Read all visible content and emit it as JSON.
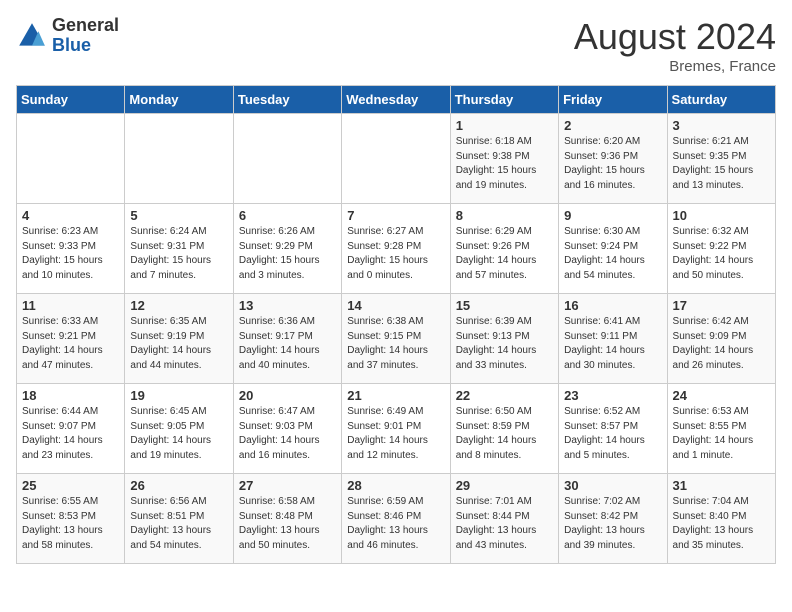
{
  "header": {
    "logo_general": "General",
    "logo_blue": "Blue",
    "month_title": "August 2024",
    "subtitle": "Bremes, France"
  },
  "days_of_week": [
    "Sunday",
    "Monday",
    "Tuesday",
    "Wednesday",
    "Thursday",
    "Friday",
    "Saturday"
  ],
  "weeks": [
    [
      {
        "day": "",
        "detail": ""
      },
      {
        "day": "",
        "detail": ""
      },
      {
        "day": "",
        "detail": ""
      },
      {
        "day": "",
        "detail": ""
      },
      {
        "day": "1",
        "detail": "Sunrise: 6:18 AM\nSunset: 9:38 PM\nDaylight: 15 hours\nand 19 minutes."
      },
      {
        "day": "2",
        "detail": "Sunrise: 6:20 AM\nSunset: 9:36 PM\nDaylight: 15 hours\nand 16 minutes."
      },
      {
        "day": "3",
        "detail": "Sunrise: 6:21 AM\nSunset: 9:35 PM\nDaylight: 15 hours\nand 13 minutes."
      }
    ],
    [
      {
        "day": "4",
        "detail": "Sunrise: 6:23 AM\nSunset: 9:33 PM\nDaylight: 15 hours\nand 10 minutes."
      },
      {
        "day": "5",
        "detail": "Sunrise: 6:24 AM\nSunset: 9:31 PM\nDaylight: 15 hours\nand 7 minutes."
      },
      {
        "day": "6",
        "detail": "Sunrise: 6:26 AM\nSunset: 9:29 PM\nDaylight: 15 hours\nand 3 minutes."
      },
      {
        "day": "7",
        "detail": "Sunrise: 6:27 AM\nSunset: 9:28 PM\nDaylight: 15 hours\nand 0 minutes."
      },
      {
        "day": "8",
        "detail": "Sunrise: 6:29 AM\nSunset: 9:26 PM\nDaylight: 14 hours\nand 57 minutes."
      },
      {
        "day": "9",
        "detail": "Sunrise: 6:30 AM\nSunset: 9:24 PM\nDaylight: 14 hours\nand 54 minutes."
      },
      {
        "day": "10",
        "detail": "Sunrise: 6:32 AM\nSunset: 9:22 PM\nDaylight: 14 hours\nand 50 minutes."
      }
    ],
    [
      {
        "day": "11",
        "detail": "Sunrise: 6:33 AM\nSunset: 9:21 PM\nDaylight: 14 hours\nand 47 minutes."
      },
      {
        "day": "12",
        "detail": "Sunrise: 6:35 AM\nSunset: 9:19 PM\nDaylight: 14 hours\nand 44 minutes."
      },
      {
        "day": "13",
        "detail": "Sunrise: 6:36 AM\nSunset: 9:17 PM\nDaylight: 14 hours\nand 40 minutes."
      },
      {
        "day": "14",
        "detail": "Sunrise: 6:38 AM\nSunset: 9:15 PM\nDaylight: 14 hours\nand 37 minutes."
      },
      {
        "day": "15",
        "detail": "Sunrise: 6:39 AM\nSunset: 9:13 PM\nDaylight: 14 hours\nand 33 minutes."
      },
      {
        "day": "16",
        "detail": "Sunrise: 6:41 AM\nSunset: 9:11 PM\nDaylight: 14 hours\nand 30 minutes."
      },
      {
        "day": "17",
        "detail": "Sunrise: 6:42 AM\nSunset: 9:09 PM\nDaylight: 14 hours\nand 26 minutes."
      }
    ],
    [
      {
        "day": "18",
        "detail": "Sunrise: 6:44 AM\nSunset: 9:07 PM\nDaylight: 14 hours\nand 23 minutes."
      },
      {
        "day": "19",
        "detail": "Sunrise: 6:45 AM\nSunset: 9:05 PM\nDaylight: 14 hours\nand 19 minutes."
      },
      {
        "day": "20",
        "detail": "Sunrise: 6:47 AM\nSunset: 9:03 PM\nDaylight: 14 hours\nand 16 minutes."
      },
      {
        "day": "21",
        "detail": "Sunrise: 6:49 AM\nSunset: 9:01 PM\nDaylight: 14 hours\nand 12 minutes."
      },
      {
        "day": "22",
        "detail": "Sunrise: 6:50 AM\nSunset: 8:59 PM\nDaylight: 14 hours\nand 8 minutes."
      },
      {
        "day": "23",
        "detail": "Sunrise: 6:52 AM\nSunset: 8:57 PM\nDaylight: 14 hours\nand 5 minutes."
      },
      {
        "day": "24",
        "detail": "Sunrise: 6:53 AM\nSunset: 8:55 PM\nDaylight: 14 hours\nand 1 minute."
      }
    ],
    [
      {
        "day": "25",
        "detail": "Sunrise: 6:55 AM\nSunset: 8:53 PM\nDaylight: 13 hours\nand 58 minutes."
      },
      {
        "day": "26",
        "detail": "Sunrise: 6:56 AM\nSunset: 8:51 PM\nDaylight: 13 hours\nand 54 minutes."
      },
      {
        "day": "27",
        "detail": "Sunrise: 6:58 AM\nSunset: 8:48 PM\nDaylight: 13 hours\nand 50 minutes."
      },
      {
        "day": "28",
        "detail": "Sunrise: 6:59 AM\nSunset: 8:46 PM\nDaylight: 13 hours\nand 46 minutes."
      },
      {
        "day": "29",
        "detail": "Sunrise: 7:01 AM\nSunset: 8:44 PM\nDaylight: 13 hours\nand 43 minutes."
      },
      {
        "day": "30",
        "detail": "Sunrise: 7:02 AM\nSunset: 8:42 PM\nDaylight: 13 hours\nand 39 minutes."
      },
      {
        "day": "31",
        "detail": "Sunrise: 7:04 AM\nSunset: 8:40 PM\nDaylight: 13 hours\nand 35 minutes."
      }
    ]
  ]
}
